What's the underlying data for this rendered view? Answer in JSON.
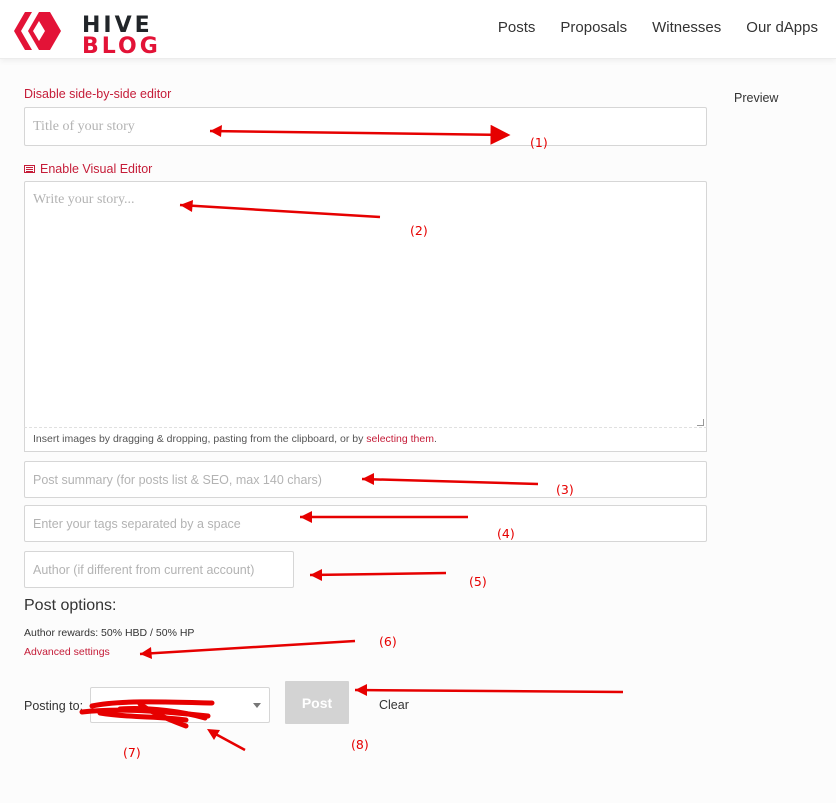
{
  "brand": {
    "line1": "HIVE",
    "line2": "BLOG"
  },
  "nav": {
    "items": [
      "Posts",
      "Proposals",
      "Witnesses",
      "Our dApps"
    ]
  },
  "editor": {
    "toggle_label": "Disable side-by-side editor",
    "preview_label": "Preview",
    "title_placeholder": "Title of your story",
    "visual_editor_label": "Enable Visual Editor",
    "body_placeholder": "Write your story...",
    "upload_hint": "Insert images by dragging & dropping, pasting from the clipboard, or by ",
    "upload_link": "selecting them",
    "upload_period": ".",
    "summary_placeholder": "Post summary (for posts list & SEO, max 140 chars)",
    "tags_placeholder": "Enter your tags separated by a space",
    "author_placeholder": "Author (if different from current account)"
  },
  "options": {
    "title": "Post options:",
    "rewards": "Author rewards: 50% HBD / 50% HP",
    "advanced_link": "Advanced settings"
  },
  "posting": {
    "label": "Posting to:",
    "post_label": "Post",
    "clear_label": "Clear"
  },
  "annotations": [
    "(1)",
    "(2)",
    "(3)",
    "(4)",
    "(5)",
    "(6)",
    "(7)",
    "(8)"
  ],
  "colors": {
    "accent": "#e31337",
    "link": "#c51c38",
    "annotation": "#e60000",
    "post_button": "#d3d3d3"
  }
}
